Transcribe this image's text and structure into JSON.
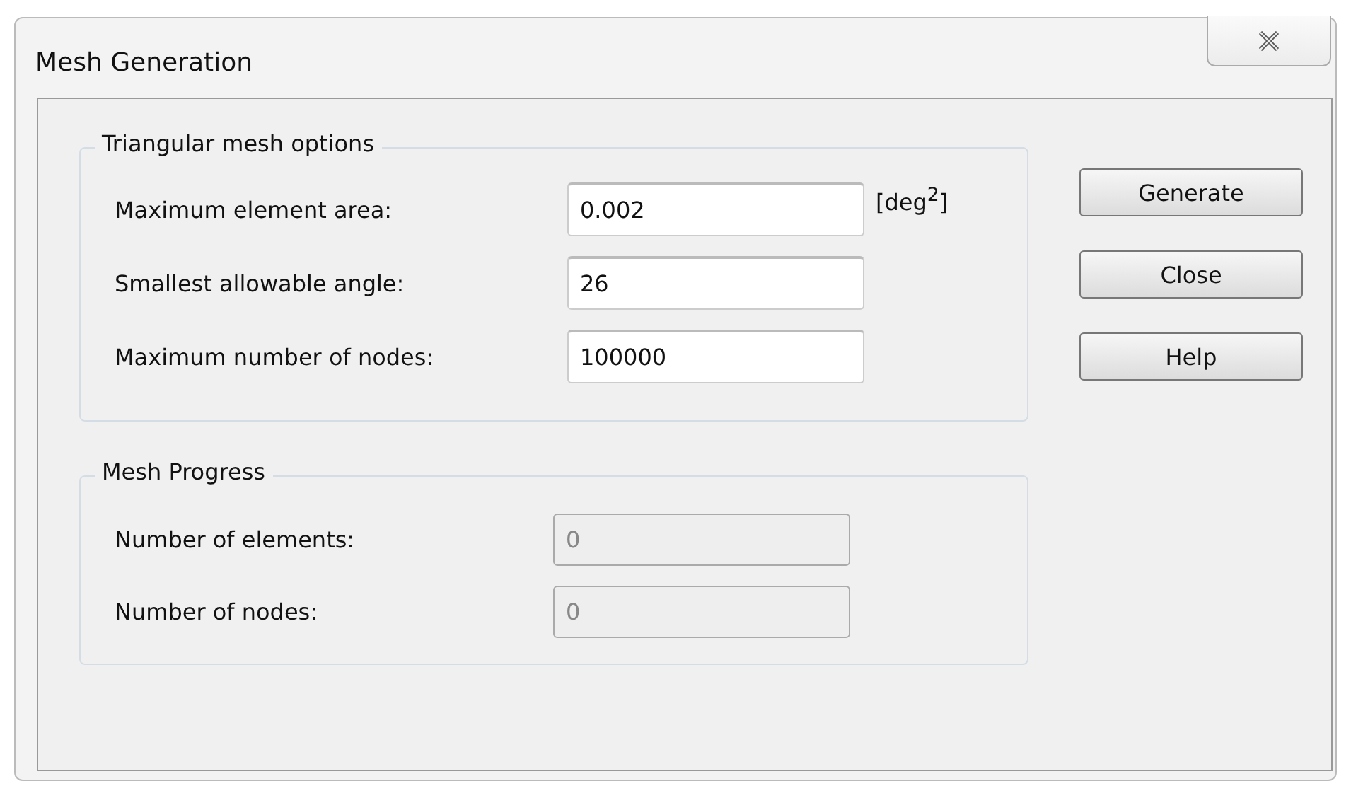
{
  "window": {
    "title": "Mesh Generation"
  },
  "mesh_options": {
    "title": "Triangular mesh options",
    "fields": [
      {
        "label": "Maximum element area:",
        "value": "0.002",
        "unit": "[deg$^{2}$]",
        "disabled": false
      },
      {
        "label": "Smallest allowable angle:",
        "value": "26",
        "disabled": false
      },
      {
        "label": "Maximum number of nodes:",
        "value": "100000",
        "disabled": false
      }
    ]
  },
  "mesh_progress": {
    "title": "Mesh Progress",
    "fields": [
      {
        "label": "Number of elements:",
        "value": "0",
        "disabled": true
      },
      {
        "label": "Number of nodes:",
        "value": "0",
        "disabled": true
      }
    ]
  },
  "buttons": [
    "Generate",
    "Close",
    "Help"
  ]
}
